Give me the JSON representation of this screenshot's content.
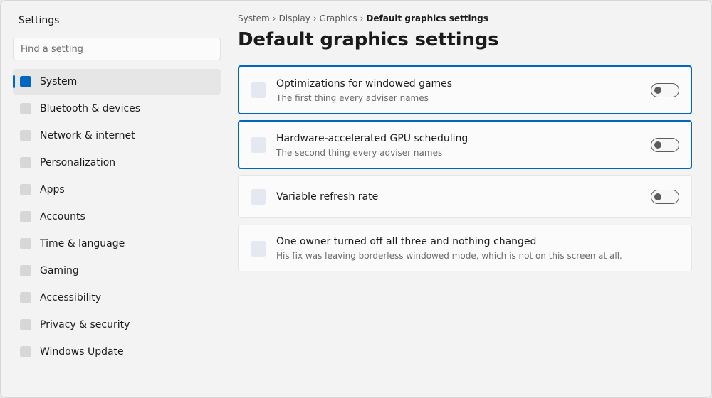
{
  "sidebar": {
    "title": "Settings",
    "search_placeholder": "Find a setting",
    "items": [
      {
        "label": "System"
      },
      {
        "label": "Bluetooth & devices"
      },
      {
        "label": "Network & internet"
      },
      {
        "label": "Personalization"
      },
      {
        "label": "Apps"
      },
      {
        "label": "Accounts"
      },
      {
        "label": "Time & language"
      },
      {
        "label": "Gaming"
      },
      {
        "label": "Accessibility"
      },
      {
        "label": "Privacy & security"
      },
      {
        "label": "Windows Update"
      }
    ],
    "active_item": "System"
  },
  "breadcrumb": {
    "items": [
      "System",
      "Display",
      "Graphics"
    ],
    "separator": "›",
    "current": "Default graphics settings"
  },
  "page": {
    "title": "Default graphics settings"
  },
  "settings": [
    {
      "title": "Optimizations for windowed games",
      "subtitle": "The first thing every adviser names",
      "toggle": "Off"
    },
    {
      "title": "Hardware-accelerated GPU scheduling",
      "subtitle": "The second thing every adviser names",
      "toggle": "Off"
    },
    {
      "title": "Variable refresh rate",
      "toggle": "Off"
    },
    {
      "title": "One owner turned off all three and nothing changed",
      "subtitle": "His fix was leaving borderless windowed mode, which is not on this screen at all."
    }
  ],
  "colors": {
    "accent": "#0067c0",
    "window_bg": "#f3f3f3",
    "card_bg": "#fbfbfb",
    "toggle_off": "#5c5c5c"
  }
}
